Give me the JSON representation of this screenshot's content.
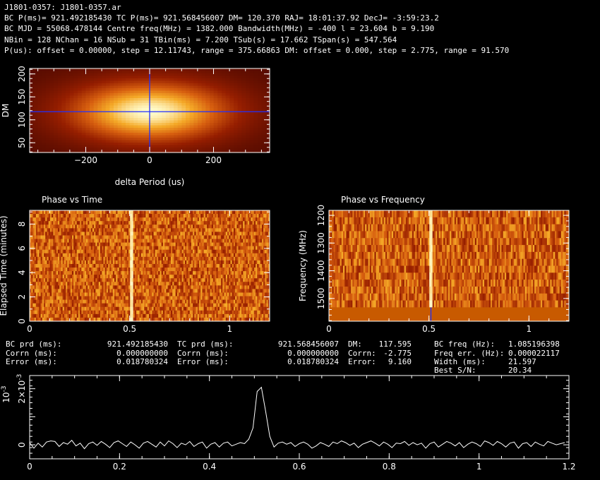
{
  "header": {
    "line1": "J1801-0357: J1801-0357.ar",
    "line2": "BC P(ms)= 921.492185430 TC P(ms)= 921.568456007 DM= 120.370 RAJ= 18:01:37.92 DecJ= -3:59:23.2",
    "line3": "BC MJD = 55068.478144 Centre freq(MHz) = 1382.000 Bandwidth(MHz) = -400 l = 23.604 b = 9.190",
    "line4": "NBin = 128 NChan = 16 NSub = 31 TBin(ms) = 7.200 TSub(s) = 17.662 TSpan(s) = 547.564",
    "line5": "P(us): offset = 0.00000, step = 12.11743, range = 375.66863 DM: offset = 0.000, step = 2.775, range = 91.570"
  },
  "stats": {
    "bc_prd_label": "BC prd (ms):",
    "bc_prd": "921.492185430",
    "bc_corrn_label": "Corrn (ms):",
    "bc_corrn": "0.000000000",
    "bc_err_label": "Error (ms):",
    "bc_err": "0.018780324",
    "tc_prd_label": "TC prd (ms):",
    "tc_prd": "921.568456007",
    "tc_corrn_label": "Corrn (ms):",
    "tc_corrn": "0.000000000",
    "tc_err_label": "Error (ms):",
    "tc_err": "0.018780324",
    "dm_label": "DM:",
    "dm": "117.595",
    "dm_corrn_label": "Corrn:",
    "dm_corrn": "-2.775",
    "dm_err_label": "Error:",
    "dm_err": "9.160",
    "bcf_label": "BC freq (Hz):",
    "bcf": "1.085196398",
    "ferr_label": "Freq err. (Hz):",
    "ferr": "0.000022117",
    "width_label": "Width (ms):",
    "width": "21.597",
    "sn_label": "Best S/N:",
    "sn": "20.34"
  },
  "colors": {
    "heat_dark": "#4a0a00",
    "heat_mid": "#d25a10",
    "heat_bright": "#fff9c8",
    "crosshair": "#2030ff",
    "freq_bar": "#c85a00"
  },
  "chart_data": [
    {
      "type": "heatmap",
      "name": "dm_vs_period",
      "xlabel": "delta Period (us)",
      "ylabel": "DM",
      "xlim": [
        -375.67,
        375.67
      ],
      "ylim": [
        28.8,
        211.9
      ],
      "xticks": [
        -200,
        0,
        200
      ],
      "yticks": [
        50,
        100,
        150,
        200
      ],
      "peak": {
        "x": 0,
        "y": 117.6
      }
    },
    {
      "type": "heatmap",
      "name": "phase_vs_time",
      "title": "Phase vs Time",
      "xlabel": "",
      "ylabel": "Elapsed Time (minutes)",
      "xlim": [
        0,
        1.2
      ],
      "ylim": [
        0,
        9.13
      ],
      "xticks": [
        0,
        0.5,
        1
      ],
      "yticks": [
        0,
        2,
        4,
        6,
        8
      ],
      "pulse_phase": 0.51,
      "nsub": 31,
      "nbin": 128
    },
    {
      "type": "heatmap",
      "name": "phase_vs_frequency",
      "title": "Phase vs Frequency",
      "xlabel": "",
      "ylabel": "Frequency (MHz)",
      "xlim": [
        0,
        1.2
      ],
      "ylim": [
        1582,
        1182
      ],
      "xticks": [
        0,
        0.5,
        1
      ],
      "yticks": [
        1200,
        1300,
        1400,
        1500
      ],
      "pulse_phase": 0.51,
      "nchan": 16,
      "masked_from_mhz": 1532
    },
    {
      "type": "line",
      "name": "profile",
      "xlabel": "",
      "ylabel": "",
      "ylabel_prefix": "10",
      "ylabel_exp": "-3",
      "xlim": [
        0,
        1.2
      ],
      "ylim": [
        -0.0005,
        0.00247
      ],
      "xticks": [
        0,
        0.2,
        0.4,
        0.6,
        0.8,
        1,
        1.2
      ],
      "yticks": [
        0,
        0.001,
        0.002
      ],
      "ytick_labels": [
        "0",
        "1",
        "2×10"
      ],
      "x": [
        0.0,
        0.0094,
        0.0188,
        0.0281,
        0.0375,
        0.0469,
        0.0563,
        0.0656,
        0.075,
        0.0844,
        0.0938,
        0.1031,
        0.1125,
        0.1219,
        0.1313,
        0.1406,
        0.15,
        0.1594,
        0.1688,
        0.1781,
        0.1875,
        0.1969,
        0.2063,
        0.2156,
        0.225,
        0.2344,
        0.2438,
        0.2531,
        0.2625,
        0.2719,
        0.2813,
        0.2906,
        0.3,
        0.3094,
        0.3188,
        0.3281,
        0.3375,
        0.3469,
        0.3563,
        0.3656,
        0.375,
        0.3844,
        0.3938,
        0.4031,
        0.4125,
        0.4219,
        0.4313,
        0.4406,
        0.45,
        0.4594,
        0.4688,
        0.4781,
        0.4875,
        0.4969,
        0.5063,
        0.5156,
        0.525,
        0.5344,
        0.5438,
        0.5531,
        0.5625,
        0.5719,
        0.5813,
        0.5906,
        0.6,
        0.6094,
        0.6188,
        0.6281,
        0.6375,
        0.6469,
        0.6563,
        0.6656,
        0.675,
        0.6844,
        0.6938,
        0.7031,
        0.7125,
        0.7219,
        0.7313,
        0.7406,
        0.75,
        0.7594,
        0.7688,
        0.7781,
        0.7875,
        0.7969,
        0.8063,
        0.8156,
        0.825,
        0.8344,
        0.8438,
        0.8531,
        0.8625,
        0.8719,
        0.8813,
        0.8906,
        0.9,
        0.9094,
        0.9188,
        0.9281,
        0.9375,
        0.9469,
        0.9563,
        0.9656,
        0.975,
        0.9844,
        0.9938,
        1.0031,
        1.0125,
        1.0219,
        1.0313,
        1.0406,
        1.05,
        1.0594,
        1.0688,
        1.0781,
        1.0875,
        1.0969,
        1.1063,
        1.1156,
        1.125,
        1.1344,
        1.1438,
        1.1531,
        1.1625,
        1.1719,
        1.1813,
        1.1906
      ],
      "values": [
        8e-05,
        -0.00012,
        6e-05,
        -8e-05,
        0.0001,
        0.00014,
        0.00012,
        -6e-05,
        8e-05,
        2e-05,
        0.00016,
        -4e-05,
        6e-05,
        -0.00014,
        4e-05,
        0.0001,
        -2e-05,
        0.00012,
        2e-05,
        -0.0001,
        8e-05,
        0.00014,
        4e-05,
        -6e-05,
        0.0001,
        0.0,
        -0.00012,
        6e-05,
        0.00012,
        2e-05,
        -8e-05,
        0.0001,
        -4e-05,
        0.00014,
        4e-05,
        -0.0001,
        6e-05,
        0.0,
        0.00012,
        -6e-05,
        4e-05,
        0.0001,
        -0.00012,
        2e-05,
        8e-05,
        -8e-05,
        6e-05,
        0.0001,
        -4e-05,
        2e-05,
        8e-05,
        4e-05,
        0.0002,
        0.0006,
        0.0019,
        0.00205,
        0.0012,
        0.0003,
        -8e-05,
        6e-05,
        0.0001,
        2e-05,
        8e-05,
        -6e-05,
        4e-05,
        0.0001,
        2e-05,
        -0.00012,
        -4e-05,
        8e-05,
        2e-05,
        -6e-05,
        0.0001,
        4e-05,
        0.00014,
        8e-05,
        -2e-05,
        6e-05,
        -0.0001,
        2e-05,
        8e-05,
        0.00014,
        6e-05,
        -4e-05,
        0.0001,
        2e-05,
        -0.0001,
        6e-05,
        4e-05,
        0.00012,
        -2e-05,
        8e-05,
        0.0,
        6e-05,
        -0.00012,
        4e-05,
        0.0001,
        -8e-05,
        2e-05,
        0.00012,
        6e-05,
        -4e-05,
        8e-05,
        -0.0001,
        2e-05,
        0.0001,
        4e-05,
        -6e-05,
        0.00014,
        8e-05,
        -2e-05,
        0.00012,
        4e-05,
        -8e-05,
        6e-05,
        0.0001,
        -0.00012,
        4e-05,
        8e-05,
        -6e-05,
        0.0001,
        2e-05,
        -4e-05,
        0.00012,
        6e-05,
        0.0,
        4e-05,
        8e-05
      ]
    }
  ]
}
